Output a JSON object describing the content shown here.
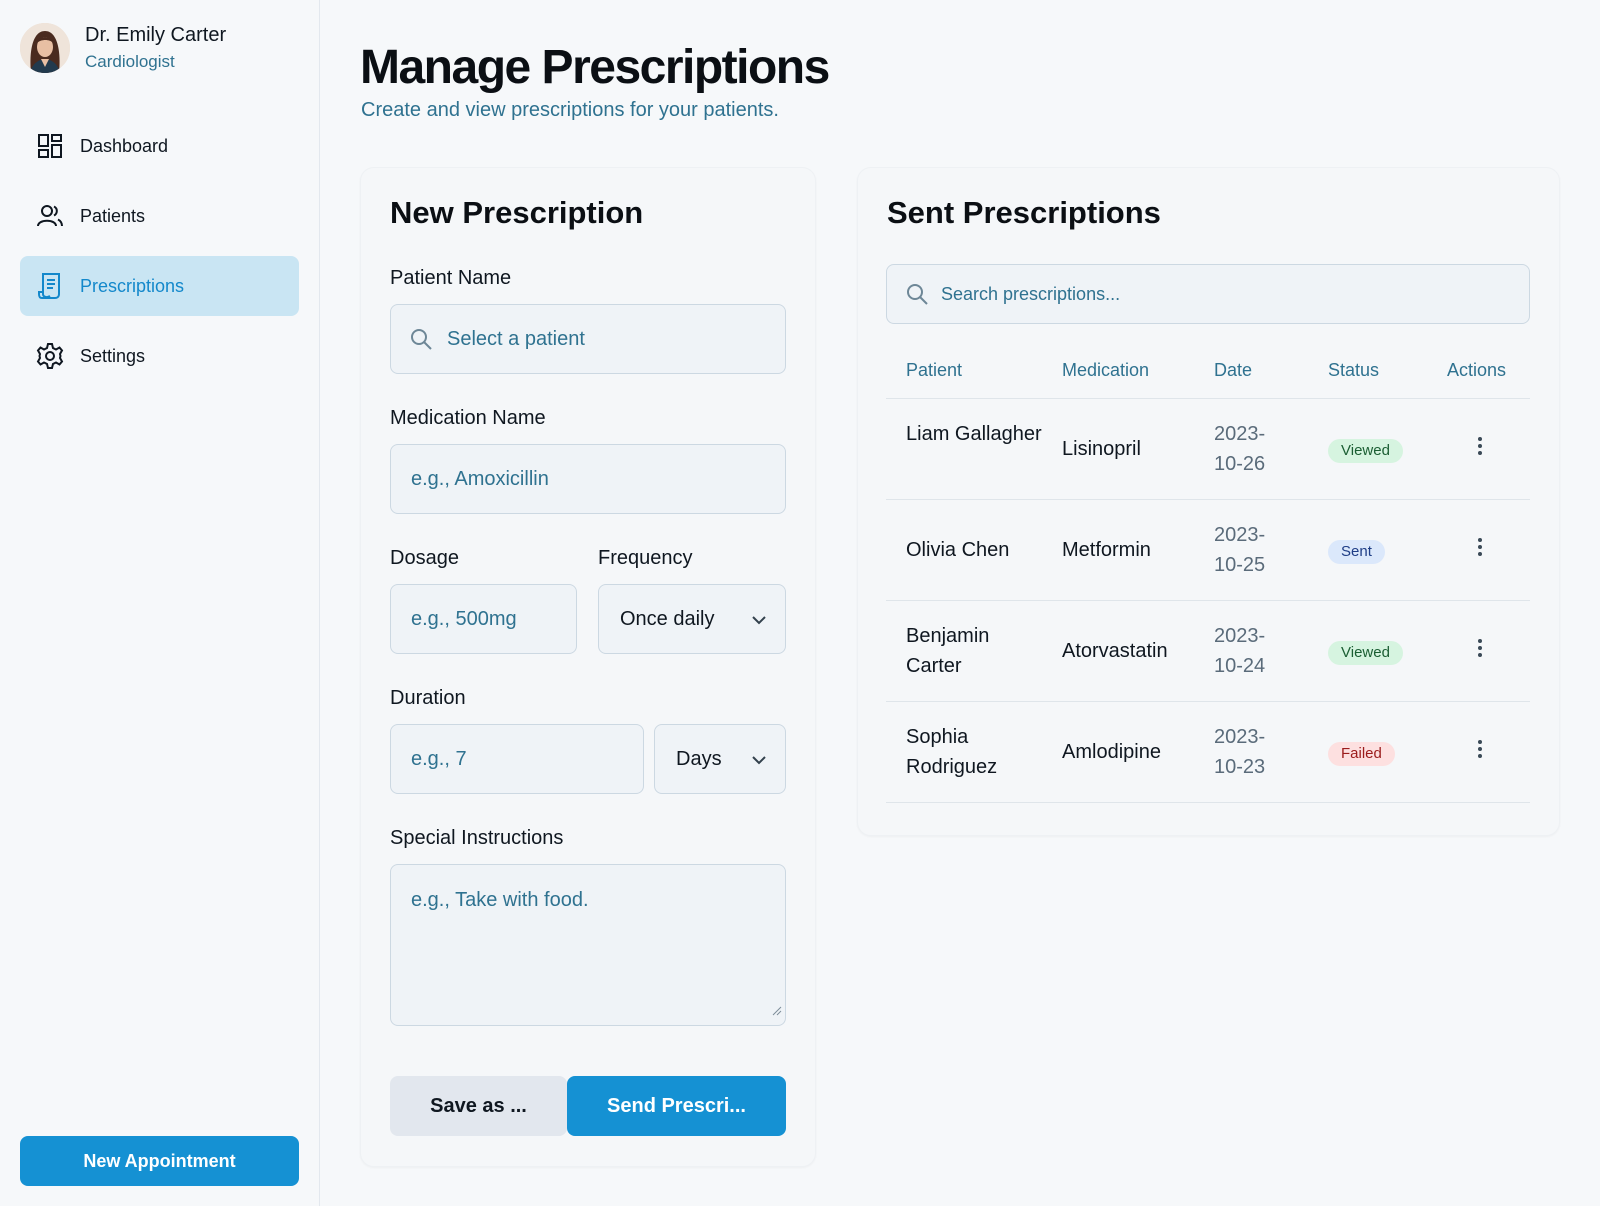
{
  "profile": {
    "name": "Dr. Emily Carter",
    "role": "Cardiologist"
  },
  "nav": [
    {
      "label": "Dashboard",
      "icon": "dashboard-icon",
      "active": false
    },
    {
      "label": "Patients",
      "icon": "patients-icon",
      "active": false
    },
    {
      "label": "Prescriptions",
      "icon": "prescriptions-icon",
      "active": true
    },
    {
      "label": "Settings",
      "icon": "gear-icon",
      "active": false
    }
  ],
  "sidebar": {
    "new_appointment_label": "New Appointment"
  },
  "page": {
    "title": "Manage Prescriptions",
    "subtitle": "Create and view prescriptions for your patients."
  },
  "form": {
    "title": "New Prescription",
    "patient_label": "Patient Name",
    "patient_placeholder": "Select a patient",
    "medication_label": "Medication Name",
    "medication_placeholder": "e.g., Amoxicillin",
    "dosage_label": "Dosage",
    "dosage_placeholder": "e.g., 500mg",
    "frequency_label": "Frequency",
    "frequency_value": "Once daily",
    "duration_label": "Duration",
    "duration_placeholder": "e.g., 7",
    "duration_unit_value": "Days",
    "instructions_label": "Special Instructions",
    "instructions_placeholder": "e.g., Take with food.",
    "save_label": "Save as ...",
    "send_label": "Send Prescri..."
  },
  "sent": {
    "title": "Sent Prescriptions",
    "search_placeholder": "Search prescriptions...",
    "columns": {
      "patient": "Patient",
      "medication": "Medication",
      "date": "Date",
      "status": "Status",
      "actions": "Actions"
    },
    "rows": [
      {
        "patient": "Liam Gallagher",
        "medication": "Lisinopril",
        "date": "2023-10-26",
        "status": "Viewed"
      },
      {
        "patient": "Olivia Chen",
        "medication": "Metformin",
        "date": "2023-10-25",
        "status": "Sent"
      },
      {
        "patient": "Benjamin Carter",
        "medication": "Atorvastatin",
        "date": "2023-10-24",
        "status": "Viewed"
      },
      {
        "patient": "Sophia Rodriguez",
        "medication": "Amlodipine",
        "date": "2023-10-23",
        "status": "Failed"
      }
    ]
  },
  "colors": {
    "accent": "#1591d3",
    "active_nav_bg": "#c9e5f3",
    "muted_text": "#2f7290",
    "viewed": "#d6f4e0",
    "sent": "#dbe8fb",
    "failed": "#fde0e0"
  }
}
